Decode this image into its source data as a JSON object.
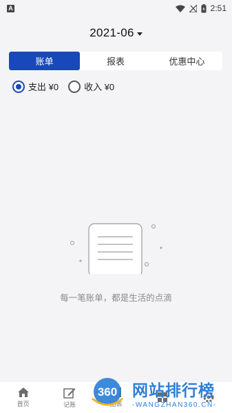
{
  "statusbar": {
    "time": "2:51",
    "app_icon": "A"
  },
  "header": {
    "month": "2021-06"
  },
  "tabs": [
    {
      "label": "账单",
      "active": true
    },
    {
      "label": "报表",
      "active": false
    },
    {
      "label": "优惠中心",
      "active": false
    }
  ],
  "filters": {
    "expense": {
      "label": "支出 ¥0",
      "checked": true
    },
    "income": {
      "label": "收入 ¥0",
      "checked": false
    }
  },
  "empty_state": {
    "text": "每一笔账单，都是生活的点滴"
  },
  "nav": {
    "items": [
      {
        "label": "首页",
        "icon": "home-icon"
      },
      {
        "label": "记账",
        "icon": "edit-icon"
      },
      {
        "label": "图表",
        "icon": "chart-icon"
      },
      {
        "label": "",
        "icon": "grid-icon"
      },
      {
        "label": "",
        "icon": "settings-icon"
      }
    ]
  },
  "watermark": {
    "badge": "360",
    "title": "网站排行榜",
    "url": "-WANGZHAN360.CN-"
  },
  "colors": {
    "accent": "#1848b9",
    "background": "#f4f4f6"
  }
}
